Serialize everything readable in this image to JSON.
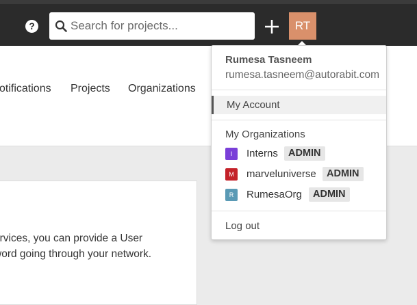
{
  "header": {
    "search_placeholder": "Search for projects...",
    "avatar_initials": "RT",
    "avatar_color": "#d9906b",
    "icons": [
      "help-icon",
      "search-icon",
      "plus-icon"
    ]
  },
  "subnav": {
    "items": [
      {
        "label": "otifications"
      },
      {
        "label": "Projects"
      },
      {
        "label": "Organizations"
      }
    ]
  },
  "content": {
    "line1": "ervices, you can provide a User",
    "line2": "word going through your network."
  },
  "dropdown": {
    "user_name": "Rumesa Tasneem",
    "user_email": "rumesa.tasneem@autorabit.com",
    "my_account_label": "My Account",
    "orgs_heading": "My Organizations",
    "orgs": [
      {
        "name": "Interns",
        "initial": "I",
        "color": "#7a3fd8",
        "role": "ADMIN"
      },
      {
        "name": "marveluniverse",
        "initial": "M",
        "color": "#c4222a",
        "role": "ADMIN"
      },
      {
        "name": "RumesaOrg",
        "initial": "R",
        "color": "#5a9ab5",
        "role": "ADMIN"
      }
    ],
    "logout_label": "Log out"
  }
}
